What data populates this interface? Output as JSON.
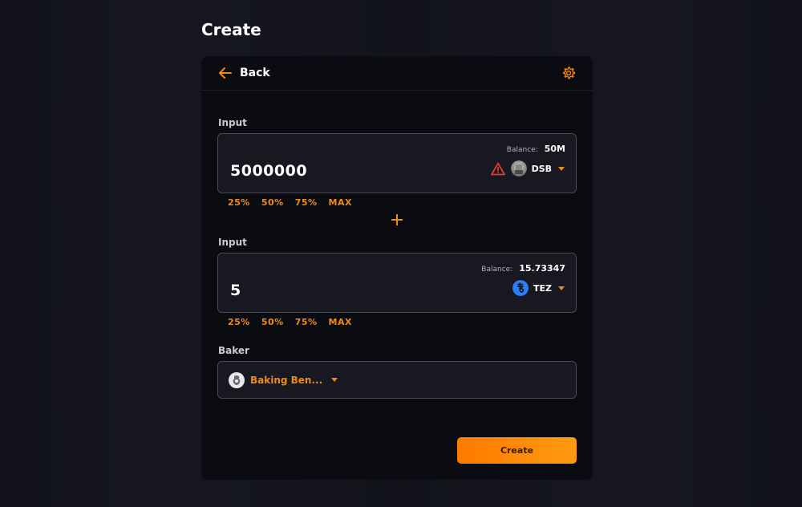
{
  "page": {
    "title": "Create"
  },
  "header": {
    "back_label": "Back"
  },
  "colors": {
    "accent": "#f08a16",
    "warning": "#e03a2f",
    "tez_blue": "#2c7df7",
    "background": "#13141c",
    "card": "#0b0c12"
  },
  "input1": {
    "label": "Input",
    "balance_label": "Balance:",
    "balance_value": "50M",
    "amount": "5000000",
    "token_symbol": "DSB",
    "warning_icon": "warning-triangle-icon",
    "percentages": [
      "25%",
      "50%",
      "75%",
      "MAX"
    ]
  },
  "input2": {
    "label": "Input",
    "balance_label": "Balance:",
    "balance_value": "15.73347",
    "amount": "5",
    "token_symbol": "TEZ",
    "percentages": [
      "25%",
      "50%",
      "75%",
      "MAX"
    ]
  },
  "baker": {
    "label": "Baker",
    "name": "Baking Ben..."
  },
  "actions": {
    "create_label": "Create"
  }
}
